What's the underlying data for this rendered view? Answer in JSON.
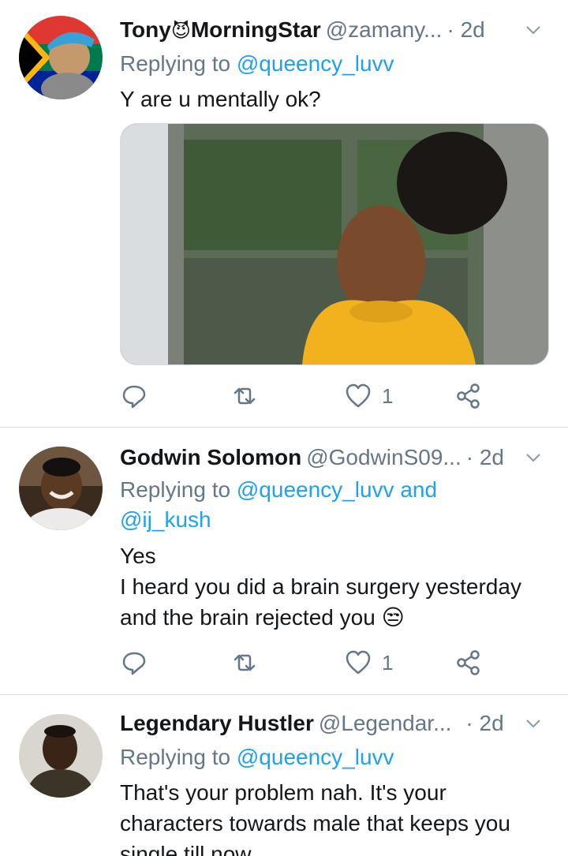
{
  "tweets": [
    {
      "name": "Tony",
      "name_emoji": "😈",
      "name_suffix": "MorningStar",
      "handle": "@zamany...",
      "time": "· 2d",
      "replying_prefix": "Replying to",
      "replying_mention": "@queency_luvv",
      "replying_extra": "",
      "body_lines": [
        "Y are u mentally ok?"
      ],
      "like_count": "1"
    },
    {
      "name": "Godwin Solomon",
      "handle": "@GodwinS09...",
      "time": "· 2d",
      "replying_prefix": "Replying to",
      "replying_mention": "@queency_luvv",
      "replying_and": "and",
      "replying_mention2": "@ij_kush",
      "body_lines": [
        "Yes",
        "I heard you did a brain surgery yesterday",
        "and the brain rejected you"
      ],
      "body_emoji": "😒",
      "like_count": "1"
    },
    {
      "name": "Legendary Hustler",
      "handle": "@Legendar...",
      "time": "· 2d",
      "replying_prefix": "Replying to",
      "replying_mention": "@queency_luvv",
      "body_lines": [
        "That's your problem nah. It's your",
        "characters towards male that keeps you",
        "single till now"
      ]
    }
  ],
  "icons": {
    "reply": "reply-icon",
    "retweet": "retweet-icon",
    "like": "heart-icon",
    "share": "share-icon",
    "menu": "chevron-down-icon"
  },
  "colors": {
    "link": "#1da1f2",
    "muted": "#657786",
    "text": "#14171a",
    "divider": "#d7dce0"
  }
}
